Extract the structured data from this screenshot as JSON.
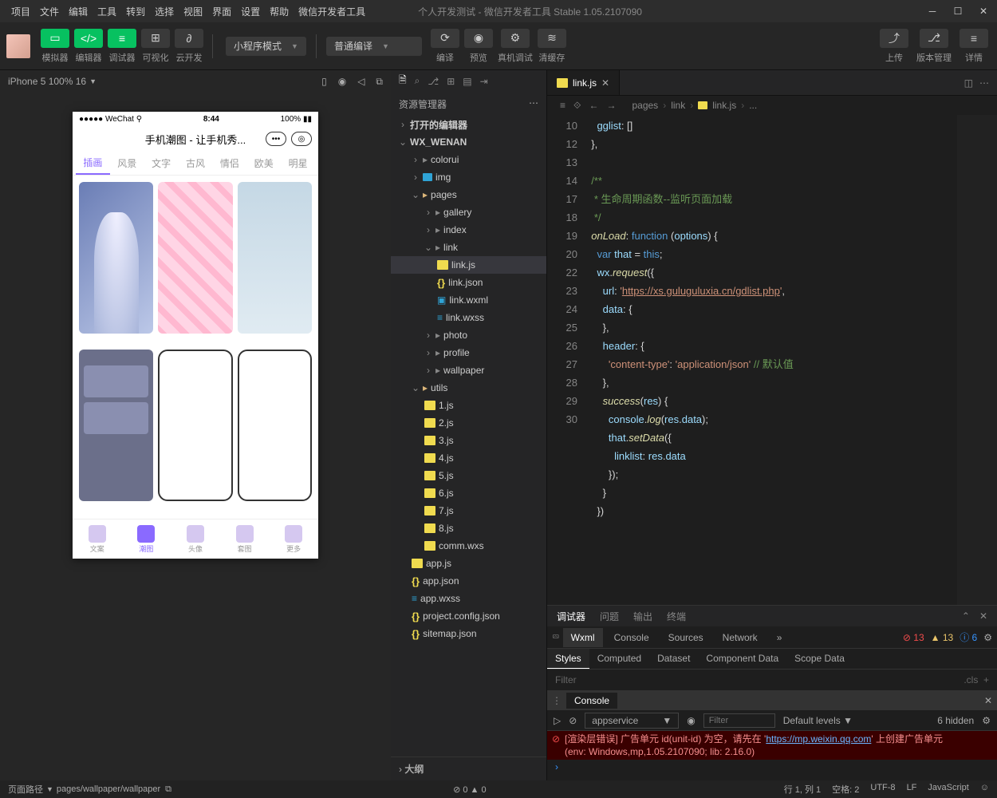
{
  "menus": [
    "项目",
    "文件",
    "编辑",
    "工具",
    "转到",
    "选择",
    "视图",
    "界面",
    "设置",
    "帮助",
    "微信开发者工具"
  ],
  "title": "个人开发测试 - 微信开发者工具 Stable 1.05.2107090",
  "toolbar": {
    "sim": "模拟器",
    "editor": "编辑器",
    "debugger": "调试器",
    "viz": "可视化",
    "cloud": "云开发",
    "mode": "小程序模式",
    "compile_mode": "普通编译",
    "compile": "编译",
    "preview": "预览",
    "remote": "真机调试",
    "clear": "清缓存",
    "upload": "上传",
    "version": "版本管理",
    "detail": "详情"
  },
  "sim": {
    "device": "iPhone 5 100% 16",
    "wechat": "WeChat",
    "time": "8:44",
    "battery": "100%",
    "app_title": "手机潮图 - 让手机秀...",
    "tabs": [
      "插画",
      "风景",
      "文字",
      "古风",
      "情侣",
      "欧美",
      "明星"
    ],
    "nav": [
      "文案",
      "潮图",
      "头像",
      "套图",
      "更多"
    ]
  },
  "explorer": {
    "title": "资源管理器",
    "open_editors": "打开的编辑器",
    "project": "WX_WENAN",
    "folders": {
      "colorui": "colorui",
      "img": "img",
      "pages": "pages",
      "gallery": "gallery",
      "index": "index",
      "link": "link",
      "photo": "photo",
      "profile": "profile",
      "wallpaper": "wallpaper",
      "utils": "utils"
    },
    "files": {
      "linkjs": "link.js",
      "linkjson": "link.json",
      "linkwxml": "link.wxml",
      "linkwxss": "link.wxss",
      "1js": "1.js",
      "2js": "2.js",
      "3js": "3.js",
      "4js": "4.js",
      "5js": "5.js",
      "6js": "6.js",
      "7js": "7.js",
      "8js": "8.js",
      "commwxs": "comm.wxs",
      "appjs": "app.js",
      "appjson": "app.json",
      "appwxss": "app.wxss",
      "projconf": "project.config.json",
      "sitemap": "sitemap.json"
    },
    "outline": "大纲"
  },
  "tabs": {
    "active": "link.js"
  },
  "breadcrumb": [
    "pages",
    "link",
    "link.js",
    "..."
  ],
  "code_lines": [
    "",
    "",
    "",
    "10",
    "",
    "12",
    "13",
    "14",
    "",
    "",
    "17",
    "18",
    "19",
    "20",
    "",
    "22",
    "23",
    "24",
    "25",
    "26",
    "27",
    "28",
    "29",
    "30"
  ],
  "debugger": {
    "head": [
      "调试器",
      "问题",
      "输出",
      "终端"
    ],
    "tabs": [
      "Wxml",
      "Console",
      "Sources",
      "Network"
    ],
    "err": "13",
    "warn": "13",
    "info": "6",
    "styles": [
      "Styles",
      "Computed",
      "Dataset",
      "Component Data",
      "Scope Data"
    ],
    "filter": "Filter",
    "cls": ".cls",
    "console": "Console",
    "context": "appservice",
    "levels": "Default levels",
    "hidden": "6 hidden",
    "msg1": "[渲染层错误] 广告单元 id(unit-id) 为空，请先在 '",
    "msg1b": "' 上创建广告单元",
    "msg1url": "https://mp.weixin.qq.com",
    "msg2": "(env: Windows,mp,1.05.2107090; lib: 2.16.0)"
  },
  "status": {
    "path_label": "页面路径",
    "path": "pages/wallpaper/wallpaper",
    "issues0": "0",
    "issues1": "0",
    "line": "行 1, 列 1",
    "spaces": "空格: 2",
    "enc": "UTF-8",
    "eol": "LF",
    "lang": "JavaScript"
  }
}
